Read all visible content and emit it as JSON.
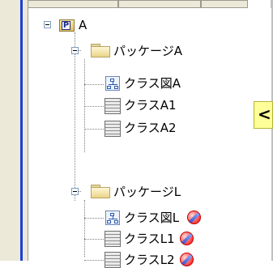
{
  "tree": {
    "root": {
      "label": "A",
      "badge": "P"
    },
    "packages": [
      {
        "label": "パッケージA",
        "items": [
          {
            "label": "クラス図A",
            "kind": "diagram",
            "status_icon": null
          },
          {
            "label": "クラスA1",
            "kind": "class",
            "status_icon": null
          },
          {
            "label": "クラスA2",
            "kind": "class",
            "status_icon": null
          }
        ]
      },
      {
        "label": "パッケージL",
        "items": [
          {
            "label": "クラス図L",
            "kind": "diagram",
            "status_icon": "lock-icon"
          },
          {
            "label": "クラスL1",
            "kind": "class",
            "status_icon": "lock-icon"
          },
          {
            "label": "クラスL2",
            "kind": "class",
            "status_icon": "lock-icon"
          }
        ]
      }
    ]
  },
  "callout": {
    "text": "<"
  },
  "colors": {
    "callout_bg": "#ffff99",
    "frame_accent": "#1c3fd6"
  }
}
